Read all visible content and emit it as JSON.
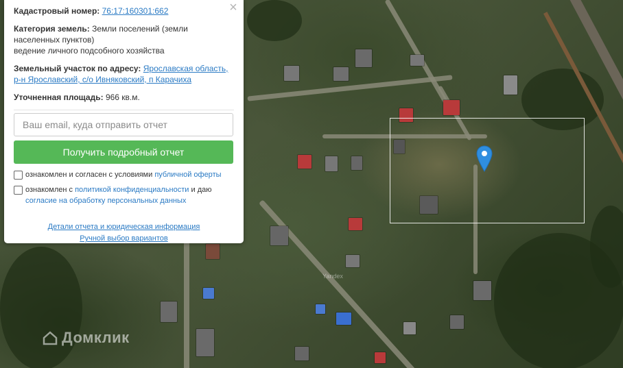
{
  "panel": {
    "cadastral_label": "Кадастровый номер:",
    "cadastral_number": "76:17:160301:662",
    "category_label": "Категория земель:",
    "category_value_1": "Земли поселений (земли",
    "category_value_2": "населенных пунктов)",
    "category_value_3": "ведение личного подсобного хозяйства",
    "address_label": "Земельный участок по адресу:",
    "address_link_1": "Ярославская область,",
    "address_link_2": "р-н Ярославский, с/о Ивняковский, п Карачиха",
    "area_label": "Уточненная площадь:",
    "area_value": "966 кв.м.",
    "email_placeholder": "Ваш email, куда отправить отчет",
    "report_button": "Получить подробный отчет",
    "offer_text": "ознакомлен и согласен с условиями",
    "offer_link": "публичной оферты",
    "privacy_text": "ознакомлен с",
    "privacy_link": "политикой конфиденциальности",
    "privacy_and": "и даю",
    "consent_link": "согласие на обработку персональных данных",
    "details_link": "Детали отчета и юридическая информация",
    "manual_link": "Ручной выбор вариантов",
    "close_symbol": "×"
  },
  "map": {
    "watermark": "Домклик",
    "yandex_mark": "Yandex"
  },
  "colors": {
    "accent_button": "#55b857",
    "link": "#2a7ac4",
    "pin": "#2f8ee0"
  }
}
